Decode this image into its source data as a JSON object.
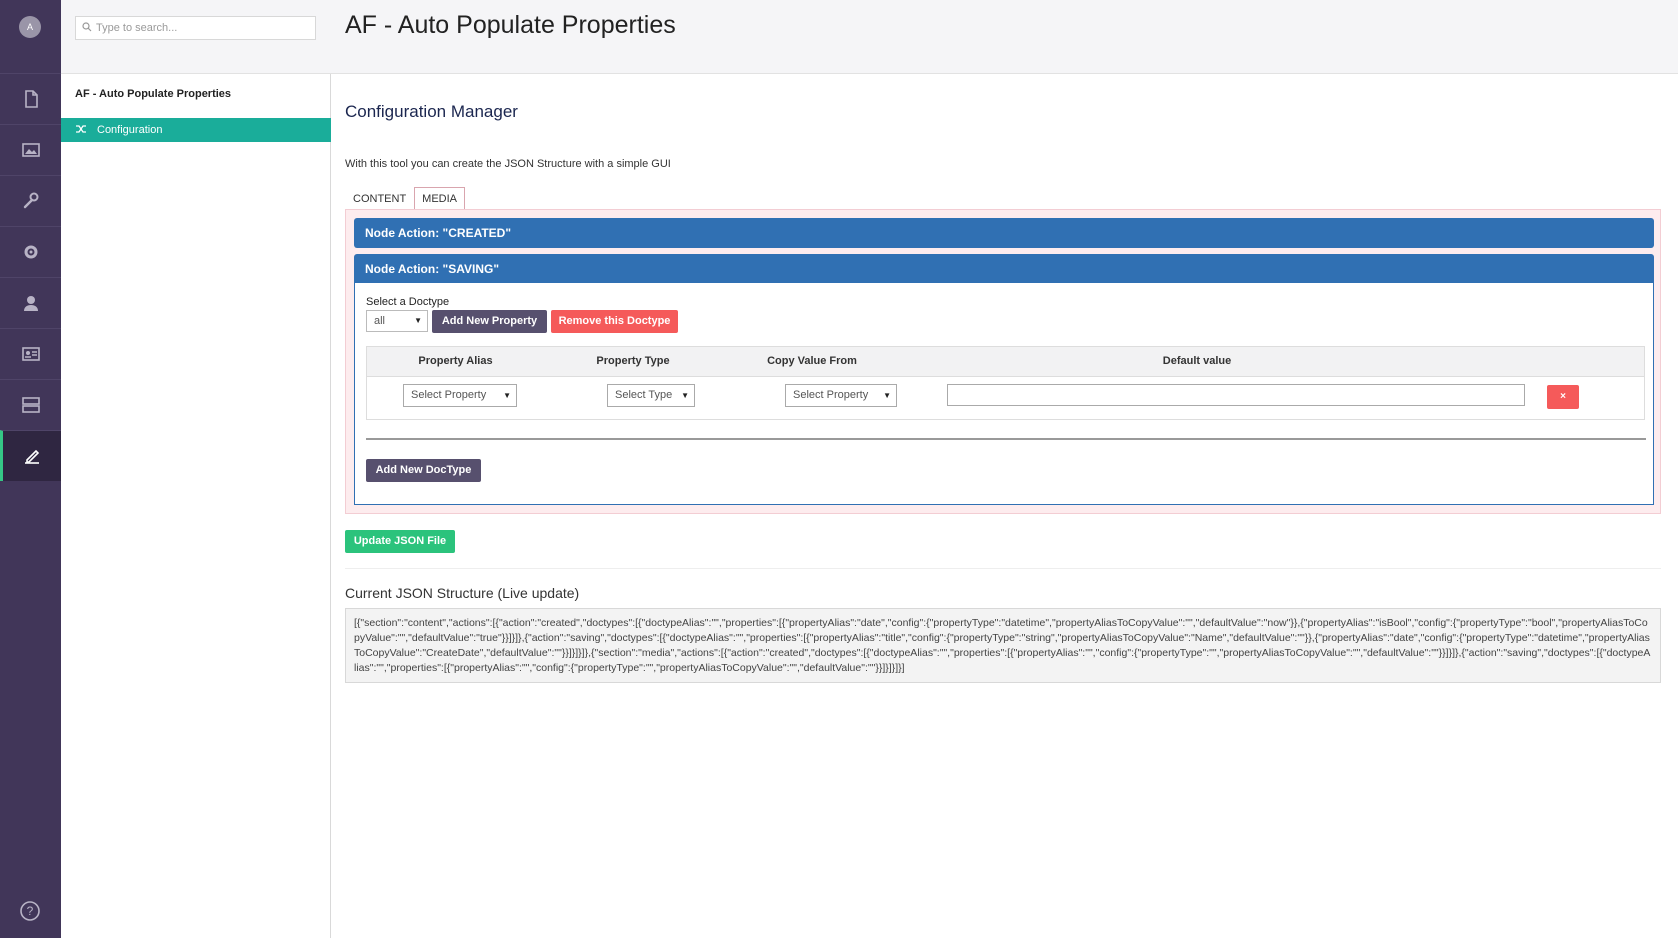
{
  "user": {
    "avatar_initial": "A"
  },
  "rail": {
    "items": [
      {
        "icon": "content-icon"
      },
      {
        "icon": "media-icon"
      },
      {
        "icon": "settings-wrench-icon"
      },
      {
        "icon": "gear-icon"
      },
      {
        "icon": "user-icon"
      },
      {
        "icon": "members-icon"
      },
      {
        "icon": "forms-icon"
      },
      {
        "icon": "edit-icon"
      }
    ],
    "active_index": 7,
    "help_icon": "help-icon"
  },
  "tree": {
    "search_placeholder": "Type to search...",
    "root_label": "AF - Auto Populate Properties",
    "selected_node": "Configuration"
  },
  "header": {
    "title": "AF - Auto Populate Properties"
  },
  "main": {
    "section_title": "Configuration Manager",
    "intro": "With this tool you can create the JSON Structure with a simple GUI",
    "tabs": [
      {
        "label": "CONTENT",
        "active": false
      },
      {
        "label": "MEDIA",
        "active": true
      }
    ],
    "accordions": [
      {
        "title": "Node Action: \"CREATED\""
      },
      {
        "title": "Node Action: \"SAVING\""
      }
    ],
    "doctype": {
      "label": "Select a Doctype",
      "selected": "all",
      "add_property_label": "Add New Property",
      "remove_doctype_label": "Remove this Doctype"
    },
    "table": {
      "headers": [
        "Property Alias",
        "Property Type",
        "Copy Value From",
        "Default value"
      ],
      "row": {
        "alias_select": "Select Property",
        "type_select": "Select Type",
        "copy_select": "Select Property",
        "default_value": "",
        "delete_label": "×"
      }
    },
    "add_doctype_label": "Add New DocType",
    "update_label": "Update JSON File",
    "json_title": "Current JSON Structure (Live update)",
    "json_text": "[{\"section\":\"content\",\"actions\":[{\"action\":\"created\",\"doctypes\":[{\"doctypeAlias\":\"\",\"properties\":[{\"propertyAlias\":\"date\",\"config\":{\"propertyType\":\"datetime\",\"propertyAliasToCopyValue\":\"\",\"defaultValue\":\"now\"}},{\"propertyAlias\":\"isBool\",\"config\":{\"propertyType\":\"bool\",\"propertyAliasToCopyValue\":\"\",\"defaultValue\":\"true\"}}]}]},{\"action\":\"saving\",\"doctypes\":[{\"doctypeAlias\":\"\",\"properties\":[{\"propertyAlias\":\"title\",\"config\":{\"propertyType\":\"string\",\"propertyAliasToCopyValue\":\"Name\",\"defaultValue\":\"\"}},{\"propertyAlias\":\"date\",\"config\":{\"propertyType\":\"datetime\",\"propertyAliasToCopyValue\":\"CreateDate\",\"defaultValue\":\"\"}}]}]}]},{\"section\":\"media\",\"actions\":[{\"action\":\"created\",\"doctypes\":[{\"doctypeAlias\":\"\",\"properties\":[{\"propertyAlias\":\"\",\"config\":{\"propertyType\":\"\",\"propertyAliasToCopyValue\":\"\",\"defaultValue\":\"\"}}]}]},{\"action\":\"saving\",\"doctypes\":[{\"doctypeAlias\":\"\",\"properties\":[{\"propertyAlias\":\"\",\"config\":{\"propertyType\":\"\",\"propertyAliasToCopyValue\":\"\",\"defaultValue\":\"\"}}]}]}]}]"
  },
  "colors": {
    "rail_bg": "#413659",
    "active_node": "#1aad9a",
    "accordion": "#3070b3",
    "danger": "#f55a5a",
    "success": "#2bc37c",
    "primary_btn": "#57506e"
  }
}
